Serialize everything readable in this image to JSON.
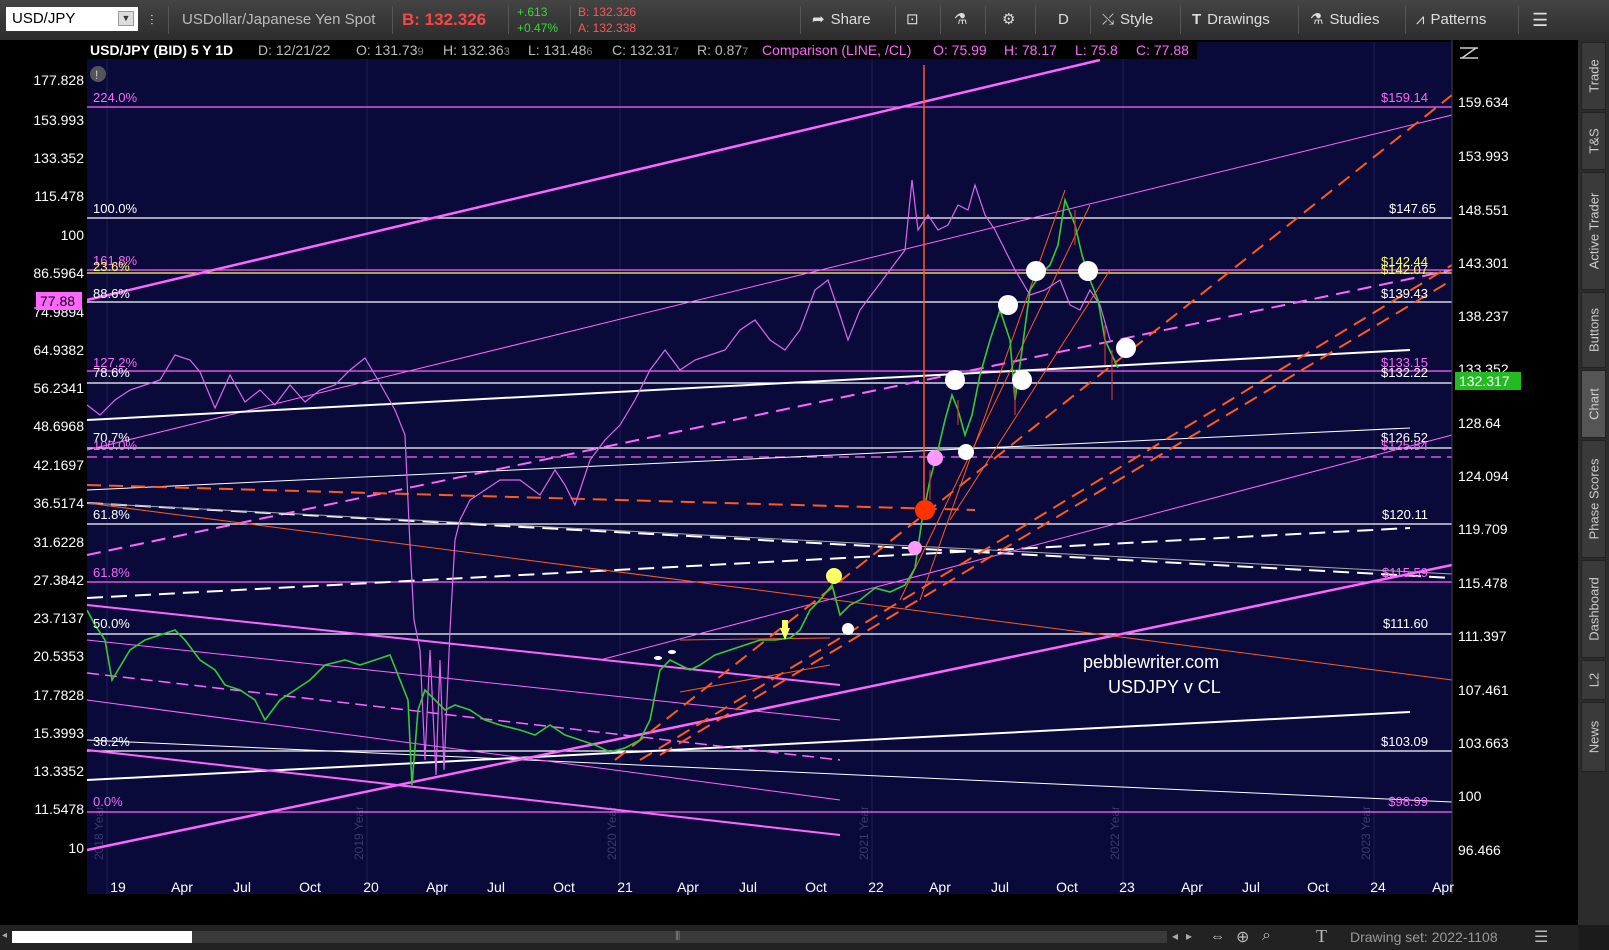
{
  "toolbar": {
    "symbol": "USD/JPY",
    "description": "USDollar/Japanese Yen Spot",
    "bid": "B: 132.326",
    "change": "+.613",
    "change_pct": "+0.47%",
    "b_small": "B: 132.326",
    "a_small": "A: 132.338",
    "share": "Share",
    "d": "D",
    "style": "Style",
    "drawings": "Drawings",
    "studies": "Studies",
    "patterns": "Patterns"
  },
  "header": {
    "title": "USD/JPY (BID) 5 Y 1D",
    "d": "D: 12/21/22",
    "o": "O: 131.73",
    "o_sub": "9",
    "h": "H: 132.36",
    "h_sub": "3",
    "l": "L: 131.48",
    "l_sub": "6",
    "c": "C: 132.31",
    "c_sub": "7",
    "r": "R: 0.87",
    "r_sub": "7",
    "comp": "Comparison (LINE, /CL)",
    "co": "O: 75.99",
    "ch": "H: 78.17",
    "cl": "L: 75.8",
    "cc": "C: 77.88"
  },
  "left_axis": [
    "177.828",
    "153.993",
    "133.352",
    "115.478",
    "100",
    "86.5964",
    "74.9894",
    "64.9382",
    "56.2341",
    "48.6968",
    "42.1697",
    "36.5174",
    "31.6228",
    "27.3842",
    "23.7137",
    "20.5353",
    "17.7828",
    "15.3993",
    "13.3352",
    "11.5478",
    "10"
  ],
  "left_marker": "77.88",
  "right_axis": [
    "159.634",
    "153.993",
    "148.551",
    "143.301",
    "138.237",
    "133.352",
    "128.64",
    "124.094",
    "119.709",
    "115.478",
    "111.397",
    "107.461",
    "103.663",
    "100",
    "96.466"
  ],
  "right_marker": "132.317",
  "x_axis": [
    "19",
    "Apr",
    "Jul",
    "Oct",
    "20",
    "Apr",
    "Jul",
    "Oct",
    "21",
    "Apr",
    "Jul",
    "Oct",
    "22",
    "Apr",
    "Jul",
    "Oct",
    "23",
    "Apr",
    "Jul",
    "Oct",
    "24",
    "Apr"
  ],
  "year_marks": [
    "2018 Year",
    "2019 Year",
    "2020 Year",
    "2021 Year",
    "2022 Year",
    "2023 Year"
  ],
  "fib_left": [
    {
      "t": "224.0%",
      "c": "#ff66ff"
    },
    {
      "t": "100.0%",
      "c": "#ffffff"
    },
    {
      "t": "161.8%",
      "c": "#ff66ff"
    },
    {
      "t": "23.6%",
      "c": "#ffff66"
    },
    {
      "t": "88.6%",
      "c": "#ffffff"
    },
    {
      "t": "127.2%",
      "c": "#ff66ff"
    },
    {
      "t": "78.6%",
      "c": "#ffffff"
    },
    {
      "t": "70.7%",
      "c": "#ffffff"
    },
    {
      "t": "100.0%",
      "c": "#ff66ff"
    },
    {
      "t": "61.8%",
      "c": "#ffffff"
    },
    {
      "t": "61.8%",
      "c": "#ff66ff"
    },
    {
      "t": "50.0%",
      "c": "#ffffff"
    },
    {
      "t": "38.2%",
      "c": "#ffffff"
    },
    {
      "t": "0.0%",
      "c": "#ff66ff"
    }
  ],
  "fib_right": [
    {
      "t": "$159.14",
      "c": "#ff66ff"
    },
    {
      "t": "$147.65",
      "c": "#ffffff"
    },
    {
      "t": "$142.44",
      "c": "#ffff66"
    },
    {
      "t": "$142.07",
      "c": "#ffffff"
    },
    {
      "t": "$139.43",
      "c": "#ffffff"
    },
    {
      "t": "$133.15",
      "c": "#ff66ff"
    },
    {
      "t": "$132.22",
      "c": "#ffffff"
    },
    {
      "t": "$126.52",
      "c": "#ffffff"
    },
    {
      "t": "$125.84",
      "c": "#ff66ff"
    },
    {
      "t": "$120.11",
      "c": "#ffffff"
    },
    {
      "t": "$115.59",
      "c": "#ff66ff"
    },
    {
      "t": "$111.60",
      "c": "#ffffff"
    },
    {
      "t": "$103.09",
      "c": "#ffffff"
    },
    {
      "t": "$98.99",
      "c": "#ff66ff"
    }
  ],
  "watermark": {
    "line1": "pebblewriter.com",
    "line2": "USDJPY v CL"
  },
  "side_tabs": [
    "Trade",
    "T&S",
    "Active Trader",
    "Buttons",
    "Chart",
    "Phase Scores",
    "Dashboard",
    "L2",
    "News"
  ],
  "footer": {
    "drawing_set": "Drawing set: 2022-1108"
  },
  "colors": {
    "bg": "#000000",
    "grid_bg": "#0a0a3a",
    "magenta": "#ff66ff",
    "orange": "#ff5a1a",
    "yellow": "#ffff66",
    "up": "#33cc33",
    "down": "#cc3333"
  }
}
